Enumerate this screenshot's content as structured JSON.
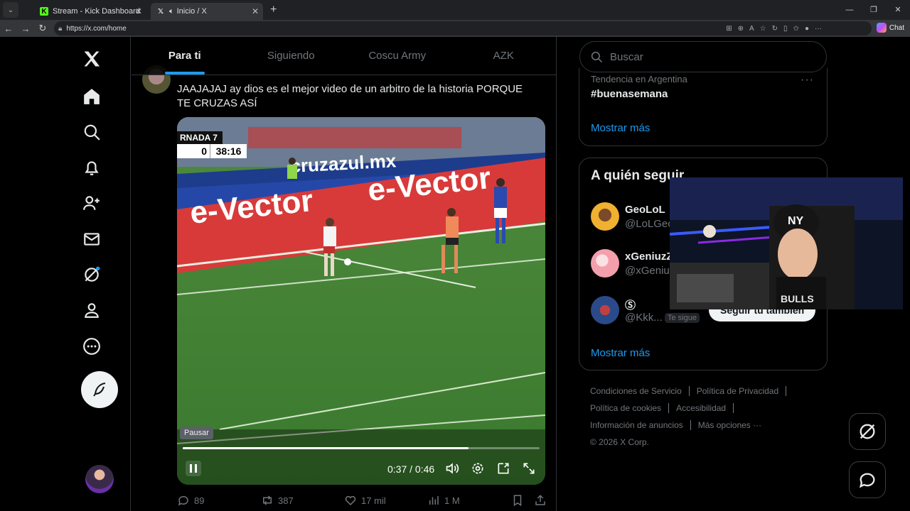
{
  "browser": {
    "tabs": [
      {
        "title": "Stream - Kick Dashboard",
        "active": false,
        "favicon": "K"
      },
      {
        "title": "Inicio / X",
        "active": true,
        "favicon": "X"
      }
    ],
    "new_tab": "+",
    "url": "https://x.com/home",
    "chat_label": "Chat"
  },
  "nav": {
    "items": [
      "home-icon",
      "search-icon",
      "notifications-icon",
      "follow-icon",
      "messages-icon",
      "grok-icon",
      "profile-icon",
      "more-icon"
    ]
  },
  "feed_tabs": [
    "Para ti",
    "Siguiendo",
    "Coscu Army",
    "AZK"
  ],
  "post": {
    "text": "JAAJAJAJ ay dios es el mejor video de un arbitro de la historia PORQUE TE CRUZAS ASÍ",
    "video": {
      "scoreboard_label": "RNADA 7",
      "score": "0",
      "clock": "38:16",
      "tooltip": "Pausar",
      "time": "0:37 / 0:46",
      "progress": 0.8
    },
    "stats": {
      "replies": "89",
      "reposts": "387",
      "likes": "17 mil",
      "views": "1 M"
    }
  },
  "search": {
    "placeholder": "Buscar"
  },
  "trends": {
    "meta": "Tendencia en Argentina",
    "name": "#buenasemana",
    "show_more": "Mostrar más"
  },
  "who_to_follow": {
    "title": "A quién seguir",
    "users": [
      {
        "name": "GeoLoL",
        "handle": "@LoLGeo",
        "color": "#f0b030"
      },
      {
        "name": "xGeniuzZ",
        "handle": "@xGeniuz",
        "color": "#f3a0ac"
      },
      {
        "name": "Ⓢ",
        "handle": "@Kkk...",
        "color": "#2a4a8a"
      }
    ],
    "follows_you": "Te sigue",
    "follow_back": "Seguir tú también",
    "show_more": "Mostrar más"
  },
  "footer": {
    "row1": [
      "Condiciones de Servicio",
      "Política de Privacidad"
    ],
    "row2": [
      "Política de cookies",
      "Accesibilidad"
    ],
    "row3": [
      "Información de anuncios",
      "Más opciones ···"
    ],
    "copyright": "© 2026 X Corp."
  },
  "colors": {
    "accent": "#1d9bf0",
    "background": "#000000",
    "muted": "#71767b"
  }
}
